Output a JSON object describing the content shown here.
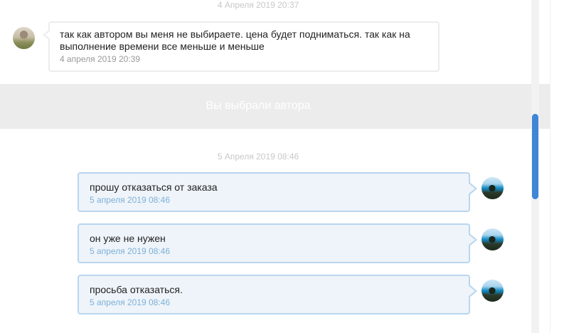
{
  "date_separators": {
    "top": "4 Апреля 2019 20:37",
    "middle": "5 Апреля 2019 08:46"
  },
  "incoming_message": {
    "text": "так как автором вы меня не выбираете. цена будет подниматься. так как на выполнение времени все меньше и меньше",
    "time": "4 апреля 2019 20:39"
  },
  "banner": {
    "text": "Вы выбрали автора"
  },
  "outgoing_messages": [
    {
      "text": "прошу отказаться от заказа",
      "time": "5 апреля 2019 08:46"
    },
    {
      "text": "он уже не нужен",
      "time": "5 апреля 2019 08:46"
    },
    {
      "text": "просьба отказаться.",
      "time": "5 апреля 2019 08:46"
    }
  ],
  "colors": {
    "outgoing_bubble_bg": "#eef4fa",
    "outgoing_bubble_border": "#b9d6ee",
    "outgoing_time": "#7fb0d6",
    "banner_bg": "#ececec",
    "scroll_thumb": "#3f86d6"
  },
  "icons": {
    "incoming_avatar": "user-avatar-photo",
    "outgoing_avatar": "user-avatar-photo-sea"
  }
}
